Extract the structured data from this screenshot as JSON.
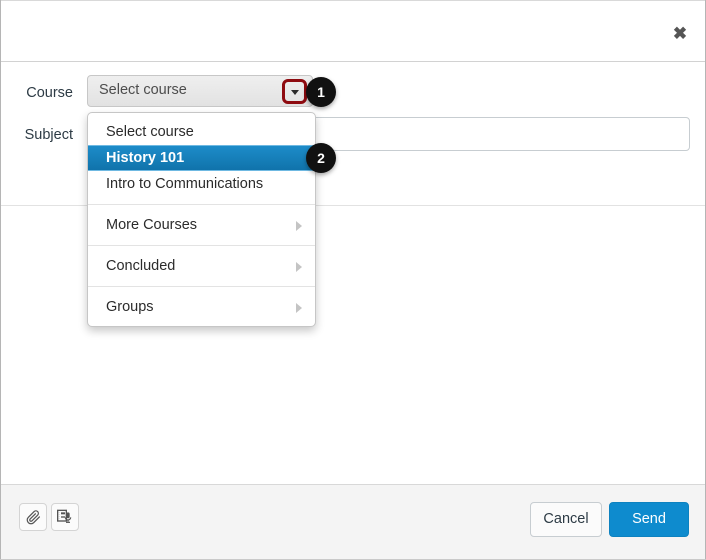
{
  "window": {
    "title": "",
    "close_label": "✖"
  },
  "form": {
    "course": {
      "label": "Course",
      "selected_value": "Select course",
      "caret_icon": "chevron-down-icon",
      "highlight_color": "#8e0b10"
    },
    "subject": {
      "label": "Subject",
      "value": "",
      "placeholder": ""
    }
  },
  "dropdown": {
    "groups": [
      {
        "items": [
          {
            "label": "Select course",
            "selected": false,
            "has_submenu": false
          },
          {
            "label": "History 101",
            "selected": true,
            "has_submenu": false
          },
          {
            "label": "Intro to Communications",
            "selected": false,
            "has_submenu": false
          }
        ]
      },
      {
        "items": [
          {
            "label": "More Courses",
            "selected": false,
            "has_submenu": true
          }
        ]
      },
      {
        "items": [
          {
            "label": "Concluded",
            "selected": false,
            "has_submenu": true
          }
        ]
      },
      {
        "items": [
          {
            "label": "Groups",
            "selected": false,
            "has_submenu": true
          }
        ]
      }
    ],
    "selected_highlight_color": "#1580bd"
  },
  "callouts": [
    {
      "number": "1",
      "target": "course-dropdown-caret"
    },
    {
      "number": "2",
      "target": "menu-item-history-101"
    }
  ],
  "footer": {
    "attach_icon": "paperclip-icon",
    "media_icon": "media-recorder-icon",
    "cancel_label": "Cancel",
    "send_label": "Send",
    "send_color": "#0e8bce"
  }
}
